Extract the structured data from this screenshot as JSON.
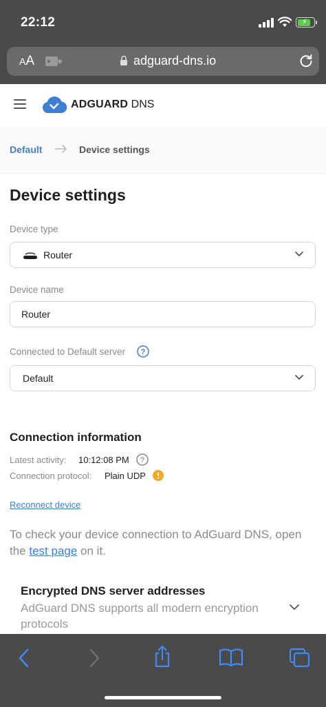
{
  "status": {
    "time": "22:12"
  },
  "browser": {
    "aa_label_small": "A",
    "aa_label_large": "A",
    "url": "adguard-dns.io"
  },
  "header": {
    "logo_bold": "ADGUARD",
    "logo_light": " DNS"
  },
  "breadcrumb": {
    "parent": "Default",
    "current": "Device settings"
  },
  "page": {
    "title": "Device settings"
  },
  "device_type": {
    "label": "Device type",
    "value": "Router"
  },
  "device_name": {
    "label": "Device name",
    "value": "Router"
  },
  "server": {
    "label": "Connected to Default server",
    "value": "Default"
  },
  "connection": {
    "title": "Connection information",
    "latest_label": "Latest activity:",
    "latest_value": "10:12:08 PM",
    "protocol_label": "Connection protocol:",
    "protocol_value": "Plain UDP"
  },
  "reconnect": {
    "label": "Reconnect device"
  },
  "check": {
    "text_before": "To check your device connection to AdGuard DNS, open the ",
    "link": "test page",
    "text_after": " on it."
  },
  "encrypted": {
    "title": "Encrypted DNS server addresses",
    "description": "AdGuard DNS supports all modern encryption protocols"
  },
  "colors": {
    "accent": "#3f7ed6",
    "chrome": "#4a4a4a",
    "warning": "#f0a92b"
  }
}
